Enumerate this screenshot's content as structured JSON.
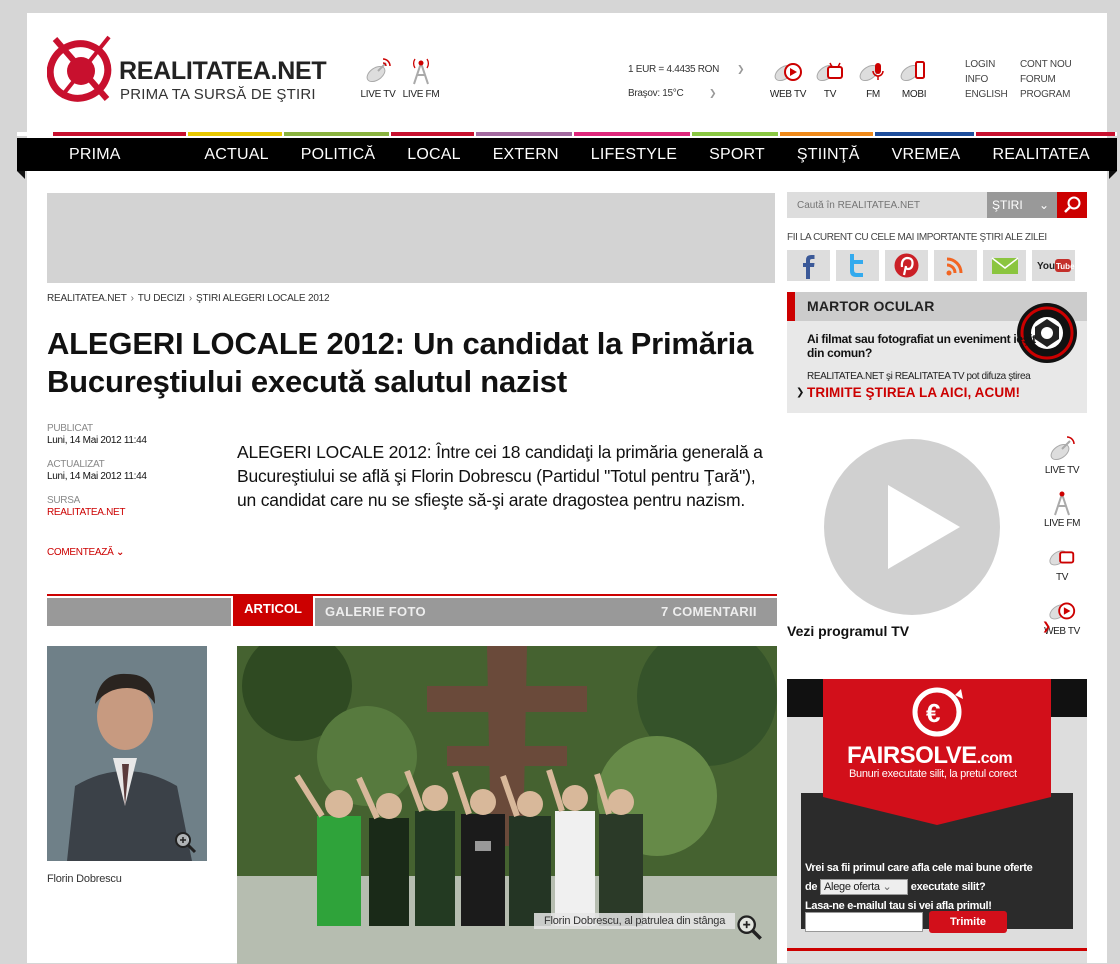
{
  "header": {
    "logo_name": "REALITATEA.NET",
    "logo_tagline": "PRIMA TA SURSĂ DE ŞTIRI",
    "media_left": [
      {
        "label": "LIVE TV",
        "icon": "satellite-dish-icon"
      },
      {
        "label": "LIVE FM",
        "icon": "radio-tower-icon"
      }
    ],
    "exchange_rate": "1 EUR = 4.4435 RON",
    "weather": "Braşov: 15°C",
    "media_right": [
      {
        "label": "WEB TV",
        "icon": "web-tv-icon"
      },
      {
        "label": "TV",
        "icon": "tv-icon"
      },
      {
        "label": "FM",
        "icon": "microphone-icon"
      },
      {
        "label": "MOBI",
        "icon": "mobile-icon"
      }
    ],
    "links_col1": [
      "LOGIN",
      "INFO",
      "ENGLISH"
    ],
    "links_col2": [
      "CONT NOU",
      "FORUM",
      "PROGRAM"
    ]
  },
  "nav": {
    "items": [
      "PRIMA PAGINA",
      "ACTUAL",
      "POLITICĂ",
      "LOCAL",
      "EXTERN",
      "LIFESTYLE",
      "SPORT",
      "ŞTIINŢĂ",
      "VREMEA",
      "REALITATEA TV"
    ],
    "colors": [
      "#c8102e",
      "#e8c800",
      "#8ab33f",
      "#c8102e",
      "#a46aa0",
      "#e0287c",
      "#8ac842",
      "#f08a1a",
      "#1e4e9c",
      "#c8102e"
    ]
  },
  "breadcrumb": [
    "REALITATEA.NET",
    "TU DECIZI",
    "ŞTIRI ALEGERI LOCALE 2012"
  ],
  "article": {
    "title": "ALEGERI LOCALE 2012: Un candidat la Primăria Bucureştiului execută salutul nazist",
    "published_label": "PUBLICAT",
    "published": "Luni, 14 Mai 2012 11:44",
    "updated_label": "ACTUALIZAT",
    "updated": "Luni, 14 Mai 2012 11:44",
    "source_label": "SURSA",
    "source": "REALITATEA.NET",
    "comment_link": "COMENTEAZĂ",
    "lead": "ALEGERI LOCALE 2012: Între cei 18 candidaţi la primăria generală a Bucureştiului se află şi Florin Dobrescu (Partidul \"Totul pentru Ţară\"), un candidat care nu se sfieşte să-şi arate dragostea pentru nazism.",
    "tabs": {
      "active": "ARTICOL",
      "gallery": "GALERIE FOTO",
      "comments": "7 COMENTARII"
    },
    "thumb_caption": "Florin Dobrescu",
    "photo_caption": "Florin Dobrescu, al patrulea din stânga"
  },
  "sidebar": {
    "search_placeholder": "Caută în REALITATEA.NET",
    "search_scope": "ŞTIRI",
    "social_title": "FII LA CURENT CU CELE MAI IMPORTANTE ŞTIRI ALE ZILEI",
    "social": [
      {
        "icon": "facebook-icon",
        "color": "#3b5998"
      },
      {
        "icon": "twitter-icon",
        "color": "#33aaee"
      },
      {
        "icon": "pinterest-icon",
        "color": "#cb2027"
      },
      {
        "icon": "rss-icon",
        "color": "#f26522"
      },
      {
        "icon": "email-icon",
        "color": "#8bc53f"
      },
      {
        "icon": "youtube-icon",
        "color": "#c4302b"
      }
    ],
    "martor": {
      "title": "MARTOR OCULAR",
      "question": "Ai filmat sau fotografiat un eveniment ieşit din comun?",
      "info": "REALITATEA.NET şi REALITATEA TV pot difuza ştirea",
      "cta": "TRIMITE ŞTIREA LA AICI, ACUM!"
    },
    "player": {
      "program_link": "Vezi programul TV",
      "buttons": [
        "LIVE TV",
        "LIVE FM",
        "TV",
        "WEB TV"
      ]
    },
    "banner": {
      "brand": "FAIRSOLVE",
      "brand_suffix": ".com",
      "tagline": "Bunuri executate silit, la pretul corect",
      "q_line1": "Vrei sa fii primul care afla cele mai bune oferte",
      "q_prefix": "de",
      "select_value": "Alege oferta",
      "q_suffix": "executate silit?",
      "q_line3": "Lasa-ne e-mailul tau si vei afla primul!",
      "send": "Trimite"
    }
  }
}
